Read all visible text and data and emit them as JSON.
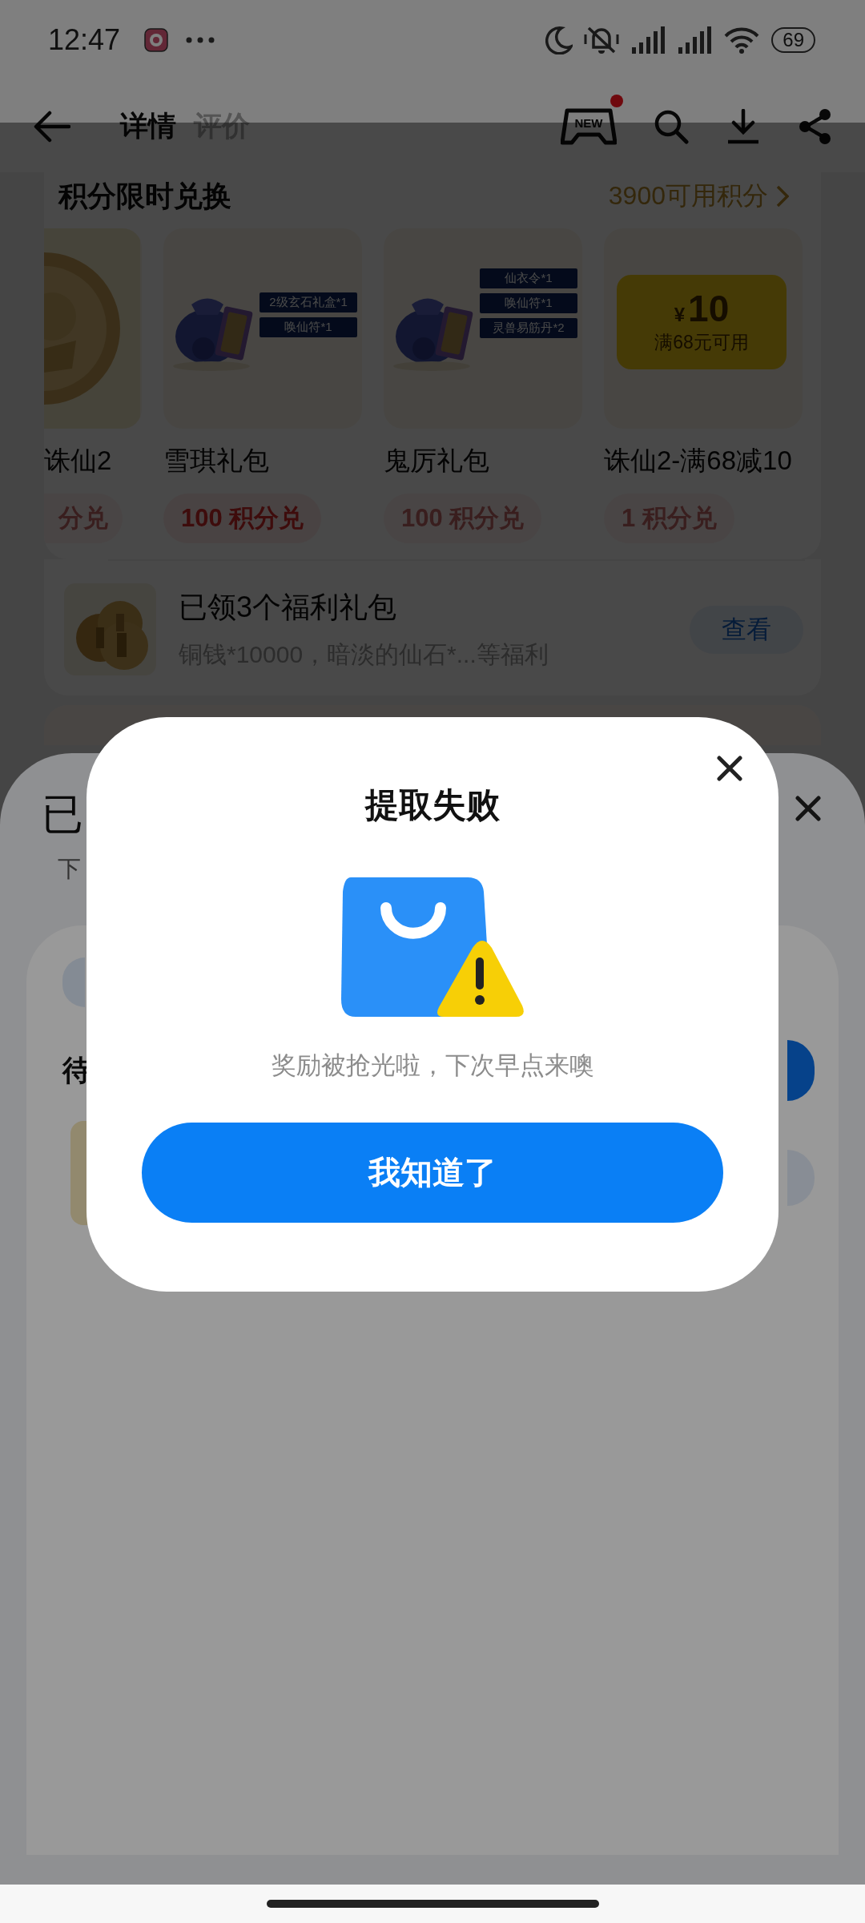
{
  "status_bar": {
    "time": "12:47",
    "battery": "69"
  },
  "nav": {
    "has_dot": true,
    "game_label": "NEW",
    "tabs": [
      {
        "label": "详情",
        "selected": true
      },
      {
        "label": "评价",
        "selected": false
      }
    ]
  },
  "exchange": {
    "title": "积分限时兑换",
    "points": "3900可用积分",
    "items": [
      {
        "kind": "coin",
        "name": "诛仙2",
        "button": "分兑",
        "disabled": true
      },
      {
        "kind": "bundle",
        "name": "雪琪礼包",
        "button": "100 积分兑",
        "disabled": false,
        "tags": [
          "2级玄石礼盒*1",
          "唤仙符*1"
        ]
      },
      {
        "kind": "bundle",
        "name": "鬼厉礼包",
        "button": "100 积分兑",
        "disabled": true,
        "tags": [
          "仙衣令*1",
          "唤仙符*1",
          "灵兽易筋丹*2"
        ]
      },
      {
        "kind": "coupon",
        "name": "诛仙2-满68减10",
        "button": "1 积分兑",
        "disabled": true,
        "coupon": {
          "currency": "¥",
          "amount": "10",
          "condition": "满68元可用"
        }
      }
    ]
  },
  "welfare": {
    "title": "已领3个福利礼包",
    "subtitle": "铜钱*10000，暗淡的仙石*...等福利",
    "button": "查看"
  },
  "sheet": {
    "title": "已",
    "subtitle": "下",
    "section": "待"
  },
  "dialog": {
    "title": "提取失败",
    "message": "奖励被抢光啦，下次早点来噢",
    "button": "我知道了"
  }
}
